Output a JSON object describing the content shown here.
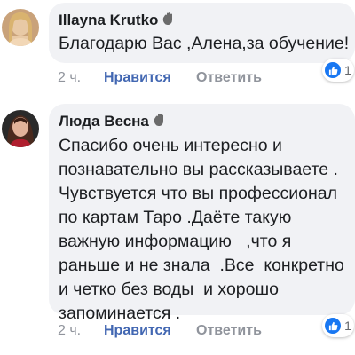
{
  "comments": [
    {
      "author": "Illayna Krutko",
      "text": "Благодарю Вас ,Алена,за обучение!",
      "likes": "1",
      "time": "2 ч.",
      "like_action": "Нравится",
      "reply_action": "Ответить"
    },
    {
      "author": "Люда Весна",
      "text": "Спасибо очень интересно и\nпознавательно вы рассказываете .\nЧувствуется что вы профессионал\nпо картам Таро .Даёте такую\nважную информацию   ,что я\nраньше и не знала  .Все  конкретно\nи четко без воды  и хорошо\nзапоминается .",
      "likes": "1",
      "time": "2 ч.",
      "like_action": "Нравится",
      "reply_action": "Ответить"
    }
  ],
  "colors": {
    "bubble": "#f1f2f5",
    "like_blue": "#1877f2",
    "link_blue": "#4267b2",
    "meta_gray": "#90949c"
  },
  "icons": [
    "waving-hand-icon",
    "thumbs-up-icon"
  ]
}
